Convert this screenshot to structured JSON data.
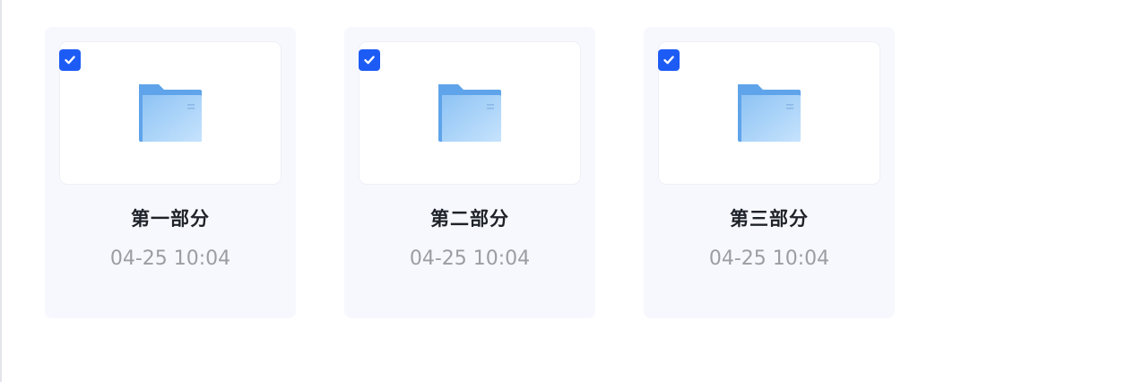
{
  "folders": [
    {
      "title": "第一部分",
      "date": "04-25 10:04",
      "selected": true
    },
    {
      "title": "第二部分",
      "date": "04-25 10:04",
      "selected": true
    },
    {
      "title": "第三部分",
      "date": "04-25 10:04",
      "selected": true
    }
  ],
  "icons": {
    "folder": "folder-icon",
    "checkbox": "checkbox-checked-icon"
  },
  "colors": {
    "accent": "#1d5bf5",
    "card_bg": "#f7f8fd",
    "folder_light": "#b3d9fb",
    "folder_dark": "#5fa4ea",
    "title_text": "#1f2329",
    "date_text": "#9a9da4"
  }
}
